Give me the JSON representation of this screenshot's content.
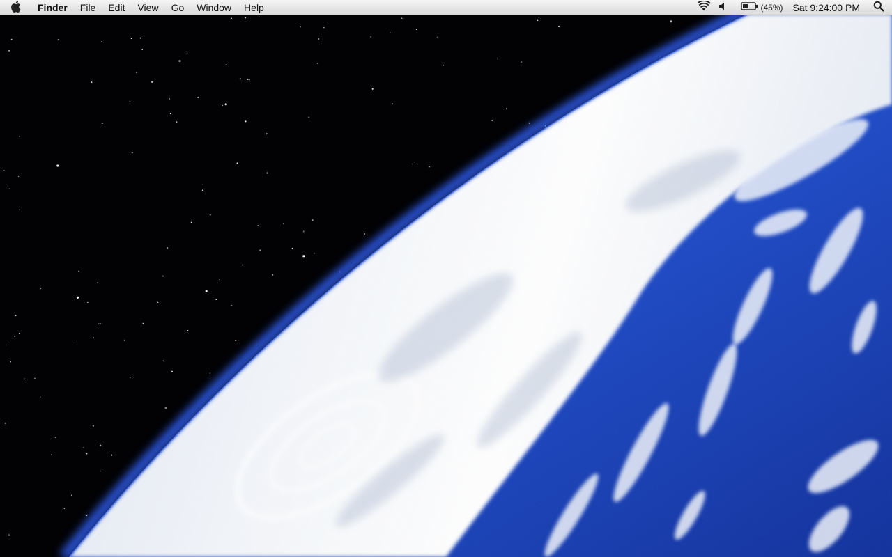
{
  "menubar": {
    "apple_icon": "apple-logo-icon",
    "app_name": "Finder",
    "menus": [
      {
        "label": "File"
      },
      {
        "label": "Edit"
      },
      {
        "label": "View"
      },
      {
        "label": "Go"
      },
      {
        "label": "Window"
      },
      {
        "label": "Help"
      }
    ],
    "status": {
      "wifi_icon": "wifi-icon",
      "volume_icon": "speaker-volume-icon",
      "battery_icon": "battery-icon",
      "battery_level": 0.45,
      "battery_percent": "(45%)",
      "clock": "Sat 9:24:00 PM",
      "spotlight_icon": "spotlight-search-icon"
    }
  },
  "desktop": {
    "wallpaper": "earth-from-space-wallpaper",
    "colors": {
      "space": "#020204",
      "ocean": "#1e4fd0",
      "clouds": "#e8eef6",
      "atmosphere": "#2f5fe8"
    }
  }
}
